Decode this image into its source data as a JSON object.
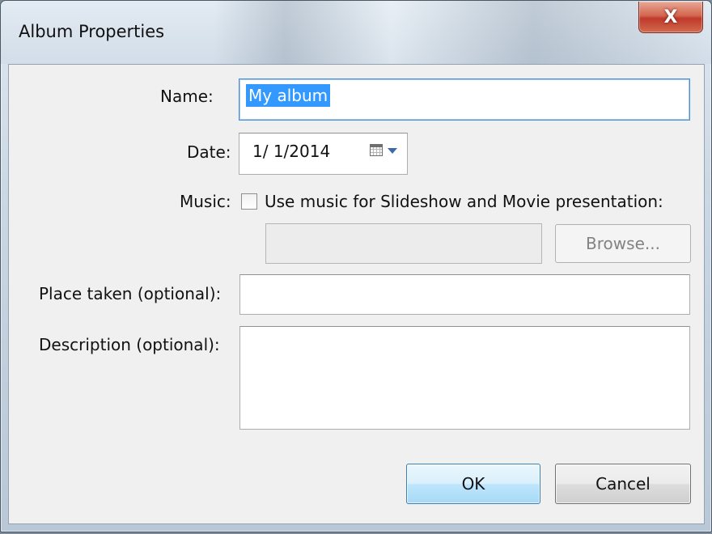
{
  "window": {
    "title": "Album Properties",
    "close_label": "X"
  },
  "fields": {
    "name_label": "Name:",
    "name_value": "My album",
    "date_label": "Date:",
    "date_value": "1/  1/2014",
    "music_label": "Music:",
    "music_checkbox_label": "Use music for Slideshow and Movie presentation:",
    "music_checked": false,
    "music_path_value": "",
    "browse_label": "Browse...",
    "place_label": "Place taken (optional):",
    "place_value": "",
    "description_label": "Description (optional):",
    "description_value": ""
  },
  "buttons": {
    "ok_label": "OK",
    "cancel_label": "Cancel"
  },
  "icons": {
    "calendar": "calendar-icon",
    "dropdown": "chevron-down-icon",
    "close": "close-icon"
  },
  "colors": {
    "selection": "#3399ff",
    "close_button": "#c0392b",
    "focus_border": "#4a90d9"
  }
}
